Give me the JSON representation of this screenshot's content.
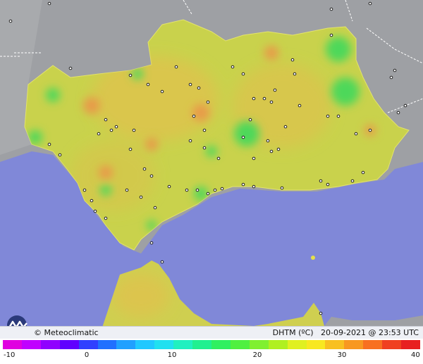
{
  "map": {
    "credit": "Meteoclimatic",
    "variable": "DHTM (ºC)",
    "date": "20-09-2021",
    "time": "23:53 UTC",
    "colors": {
      "land_bg": "#9ea0a4",
      "sea": "#8088d8",
      "region_base": "#c9d24c",
      "warm_spot": "#e89a48",
      "cool_spot": "#4ed85a",
      "station_marker": "#222222"
    }
  },
  "scale": {
    "ticks": [
      "-10",
      "0",
      "10",
      "20",
      "30",
      "40"
    ],
    "colors": [
      "#e000e0",
      "#c000ff",
      "#9000ff",
      "#6000ff",
      "#3040ff",
      "#2070ff",
      "#20a0ff",
      "#20c8ff",
      "#20e0f0",
      "#20f0c0",
      "#20f090",
      "#30f060",
      "#50f040",
      "#80f030",
      "#b0f020",
      "#e0f020",
      "#f8e820",
      "#f8c020",
      "#f89820",
      "#f87020",
      "#f04020",
      "#e82020"
    ]
  }
}
